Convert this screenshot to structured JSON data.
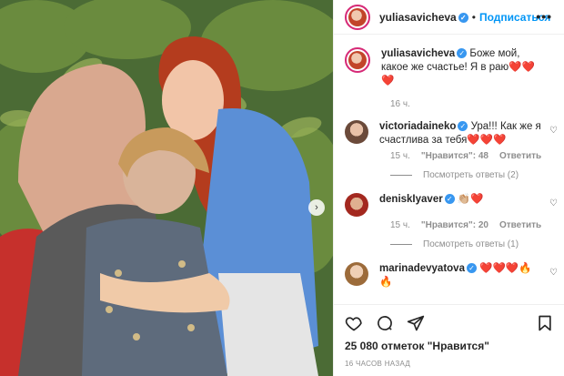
{
  "post": {
    "username": "yuliasavicheva",
    "follow_label": "Подписаться",
    "caption": {
      "username": "yuliasavicheva",
      "text": "Боже мой, какое же счастье! Я в раю❤️❤️❤️",
      "time": "16 ч."
    },
    "comments": [
      {
        "username": "victoriadaineko",
        "text": "Ура!!! Как же я счастлива за тебя❤️❤️❤️",
        "time": "15 ч.",
        "likes": "\"Нравится\": 48",
        "reply": "Ответить",
        "replies": "Посмотреть ответы (2)"
      },
      {
        "username": "deniskIyaver",
        "text": "👏🏼❤️",
        "time": "15 ч.",
        "likes": "\"Нравится\": 20",
        "reply": "Ответить",
        "replies": "Посмотреть ответы (1)"
      },
      {
        "username": "marinadevyatova",
        "text": "❤️❤️❤️🔥🔥"
      }
    ],
    "likes_count": "25 080 отметок \"Нравится\"",
    "time_ago": "16 ЧАСОВ НАЗАД"
  },
  "icons": [
    "verified-icon",
    "more-icon",
    "heart-icon",
    "comment-icon",
    "share-icon",
    "bookmark-icon",
    "chevron-right-icon"
  ],
  "colors": {
    "accent": "#0095f6",
    "verified": "#3897f0"
  }
}
